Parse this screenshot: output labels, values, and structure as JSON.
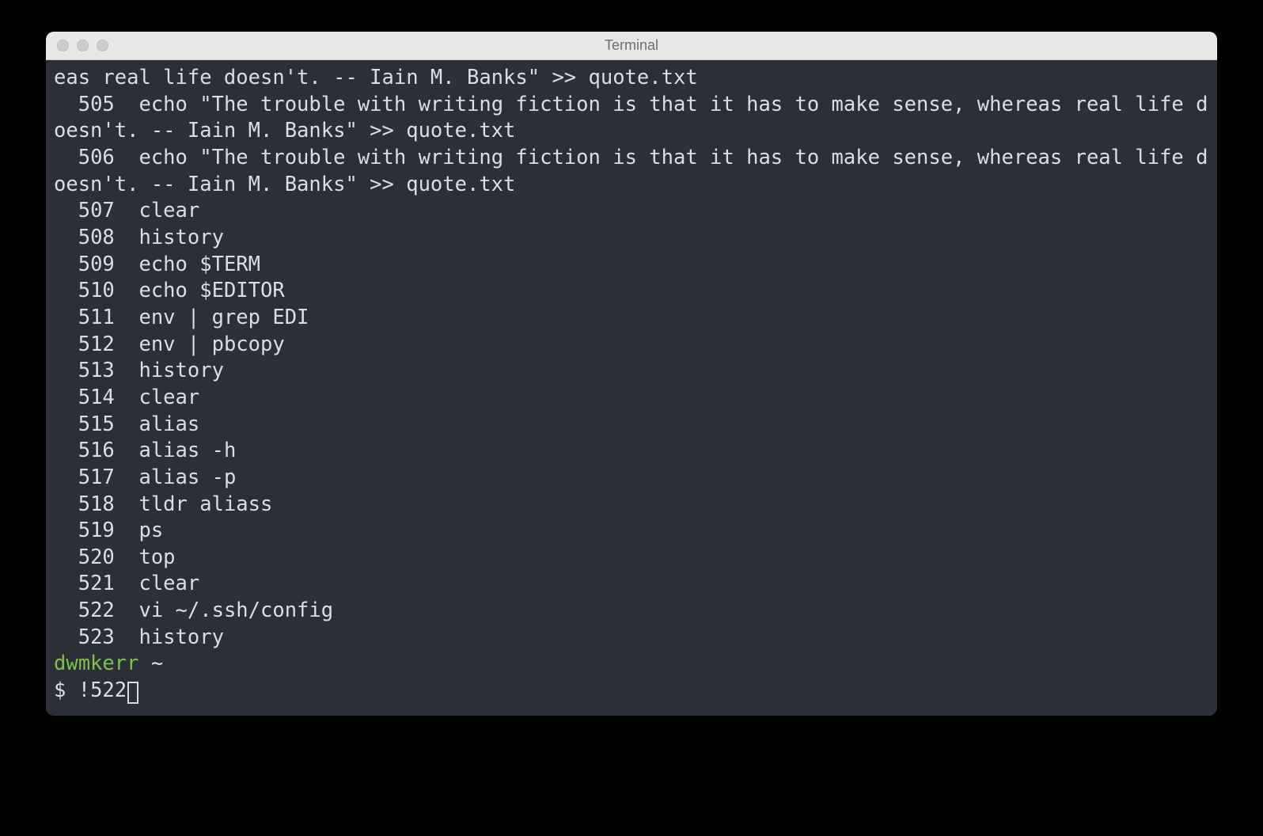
{
  "window": {
    "title": "Terminal"
  },
  "terminal": {
    "overflow_line": "eas real life doesn't. -- Iain M. Banks\" >> quote.txt",
    "history": [
      {
        "num": "  505",
        "cmd": "echo \"The trouble with writing fiction is that it has to make sense, whereas real life doesn't. -- Iain M. Banks\" >> quote.txt"
      },
      {
        "num": "  506",
        "cmd": "echo \"The trouble with writing fiction is that it has to make sense, whereas real life doesn't. -- Iain M. Banks\" >> quote.txt"
      },
      {
        "num": "  507",
        "cmd": "clear"
      },
      {
        "num": "  508",
        "cmd": "history"
      },
      {
        "num": "  509",
        "cmd": "echo $TERM"
      },
      {
        "num": "  510",
        "cmd": "echo $EDITOR"
      },
      {
        "num": "  511",
        "cmd": "env | grep EDI"
      },
      {
        "num": "  512",
        "cmd": "env | pbcopy"
      },
      {
        "num": "  513",
        "cmd": "history"
      },
      {
        "num": "  514",
        "cmd": "clear"
      },
      {
        "num": "  515",
        "cmd": "alias"
      },
      {
        "num": "  516",
        "cmd": "alias -h"
      },
      {
        "num": "  517",
        "cmd": "alias -p"
      },
      {
        "num": "  518",
        "cmd": "tldr aliass"
      },
      {
        "num": "  519",
        "cmd": "ps"
      },
      {
        "num": "  520",
        "cmd": "top"
      },
      {
        "num": "  521",
        "cmd": "clear"
      },
      {
        "num": "  522",
        "cmd": "vi ~/.ssh/config"
      },
      {
        "num": "  523",
        "cmd": "history"
      }
    ],
    "prompt": {
      "user": "dwmkerr",
      "cwd": "~",
      "symbol": "$",
      "typed": "!522"
    }
  }
}
